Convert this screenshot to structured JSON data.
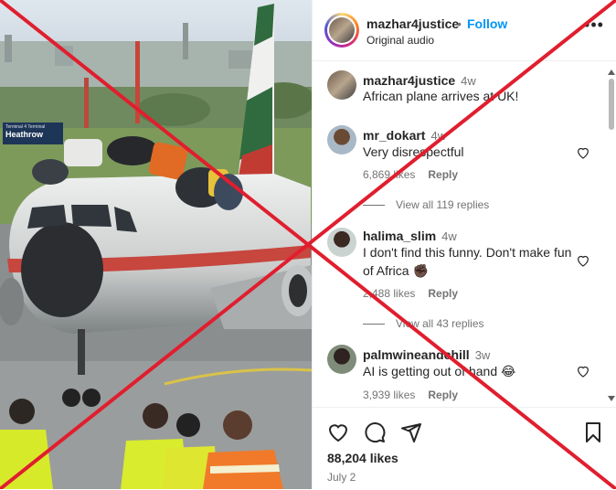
{
  "post": {
    "username": "mazhar4justice",
    "separator": "•",
    "follow_label": "Follow",
    "audio": "Original audio",
    "more_label": "•••",
    "likes": "88,204 likes",
    "date": "July 2"
  },
  "media": {
    "sign_line1": "Terminal 4 Terminal",
    "sign_line2": "Heathrow"
  },
  "comments": [
    {
      "username": "mazhar4justice",
      "time": "4w",
      "text": "African plane arrives at UK!"
    },
    {
      "username": "mr_dokart",
      "time": "4w",
      "text": "Very disrespectful",
      "likes": "6,869 likes",
      "reply": "Reply",
      "view_replies": "View all 119 replies"
    },
    {
      "username": "halima_slim",
      "time": "4w",
      "text": "I don't find this funny. Don't make fun of Africa ✊🏿",
      "likes": "2,488 likes",
      "reply": "Reply",
      "view_replies": "View all 43 replies"
    },
    {
      "username": "palmwineandchill",
      "time": "3w",
      "text": "AI is getting out of hand 😂",
      "likes": "3,939 likes",
      "reply": "Reply"
    }
  ],
  "icons": {
    "like": "heart-icon",
    "comment": "comment-icon",
    "share": "share-icon",
    "save": "bookmark-icon",
    "more": "more-icon"
  },
  "colors": {
    "follow": "#0095f6",
    "overlay_x": "#e01e2e",
    "text": "#262626",
    "muted": "#737373"
  }
}
